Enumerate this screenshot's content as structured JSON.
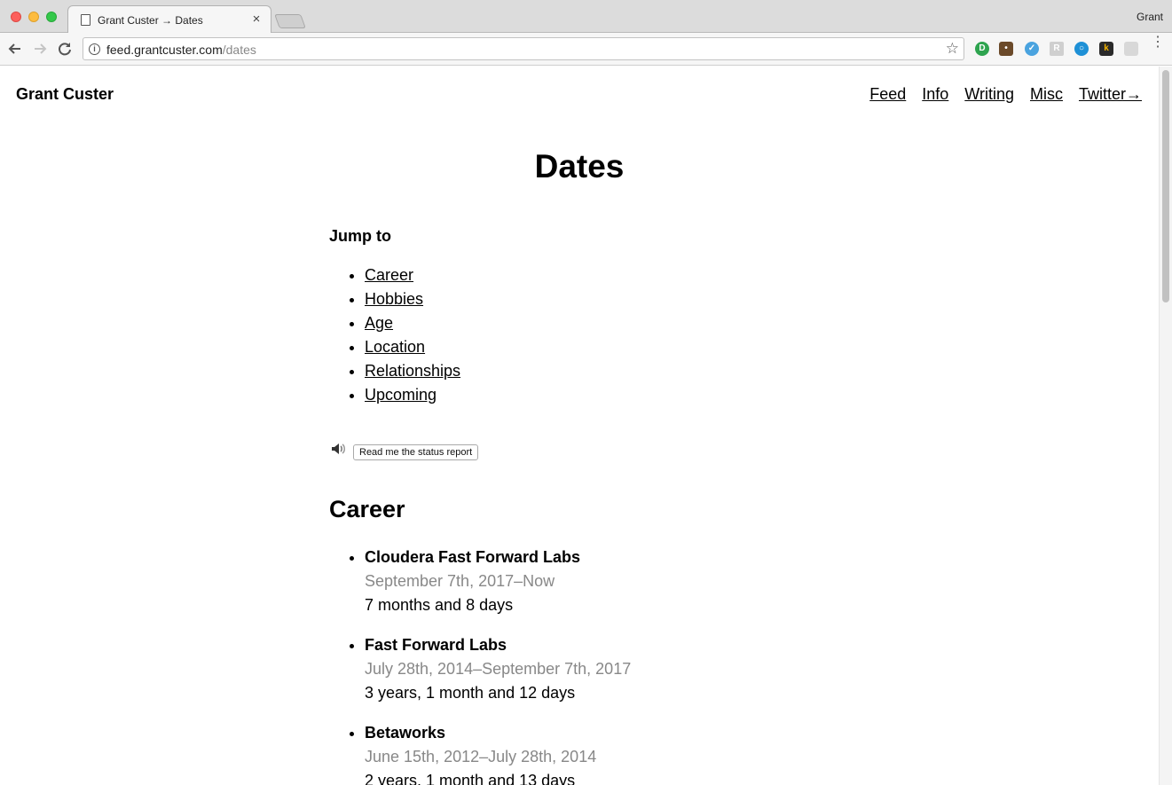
{
  "browser": {
    "tab_title": "Grant Custer → Dates",
    "tab_close": "×",
    "profile_name": "Grant",
    "url_host": "feed.grantcuster.com",
    "url_path": "/dates"
  },
  "site": {
    "title": "Grant Custer",
    "nav": [
      {
        "label": "Feed"
      },
      {
        "label": "Info"
      },
      {
        "label": "Writing"
      },
      {
        "label": "Misc"
      },
      {
        "label": "Twitter→"
      }
    ]
  },
  "page": {
    "title": "Dates",
    "jump_heading": "Jump to",
    "jump_links": [
      "Career",
      "Hobbies",
      "Age",
      "Location",
      "Relationships",
      "Upcoming"
    ],
    "status_button": "Read me the status report"
  },
  "career": {
    "heading": "Career",
    "items": [
      {
        "name": "Cloudera Fast Forward Labs",
        "range": "September 7th, 2017–Now",
        "duration": "7 months and 8 days"
      },
      {
        "name": "Fast Forward Labs",
        "range": "July 28th, 2014–September 7th, 2017",
        "duration": "3 years, 1 month and 12 days"
      },
      {
        "name": "Betaworks",
        "range": "June 15th, 2012–July 28th, 2014",
        "duration": "2 years, 1 month and 13 days"
      }
    ]
  },
  "icons": {
    "back": "arrow-left-icon",
    "forward": "arrow-right-icon",
    "reload": "reload-icon",
    "info": "info-icon",
    "star": "star-icon",
    "speaker": "speaker-icon",
    "menu": "kebab-menu-icon"
  }
}
